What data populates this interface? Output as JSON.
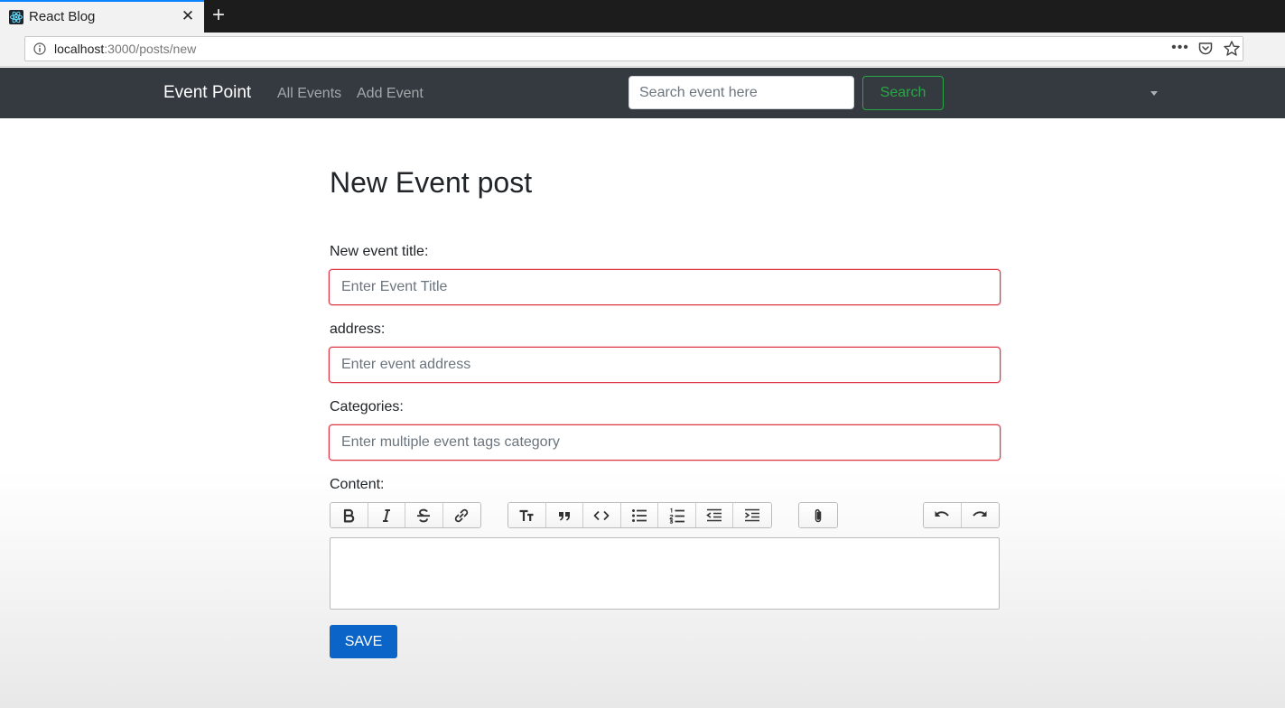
{
  "browser": {
    "tab_title": "React Blog",
    "tab_close": "✕",
    "new_tab": "+",
    "url_host": "localhost",
    "url_rest": ":3000/posts/new",
    "more_menu": "•••"
  },
  "navbar": {
    "brand": "Event Point",
    "links": [
      "All Events",
      "Add Event"
    ],
    "search_placeholder": "Search event here",
    "search_button": "Search"
  },
  "form": {
    "title": "New Event post",
    "fields": [
      {
        "label": "New event title:",
        "placeholder": "Enter Event Title"
      },
      {
        "label": "address:",
        "placeholder": "Enter event address"
      },
      {
        "label": "Categories:",
        "placeholder": "Enter multiple event tags category"
      }
    ],
    "content_label": "Content:",
    "toolbar_icons": [
      "bold-icon",
      "italic-icon",
      "strikethrough-icon",
      "link-icon",
      "heading-icon",
      "quote-icon",
      "code-icon",
      "bullet-list-icon",
      "numbered-list-icon",
      "decrease-indent-icon",
      "increase-indent-icon",
      "attach-icon",
      "undo-icon",
      "redo-icon"
    ],
    "save_button": "SAVE"
  },
  "colors": {
    "navbar_bg": "#343a40",
    "invalid_border": "#dc3545",
    "search_green": "#28a745",
    "save_blue": "#0b64c8"
  }
}
